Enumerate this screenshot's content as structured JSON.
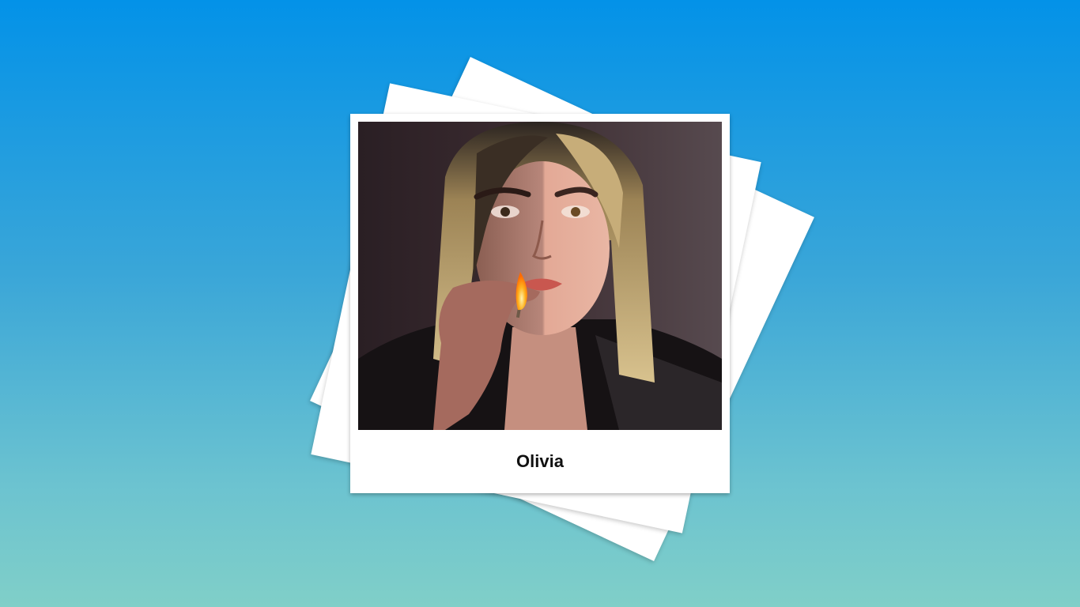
{
  "polaroid": {
    "caption": "Olivia",
    "photo_alt": "Olivia"
  },
  "colors": {
    "background_top": "#0392e8",
    "background_bottom": "#80cfc8",
    "card": "#ffffff"
  }
}
